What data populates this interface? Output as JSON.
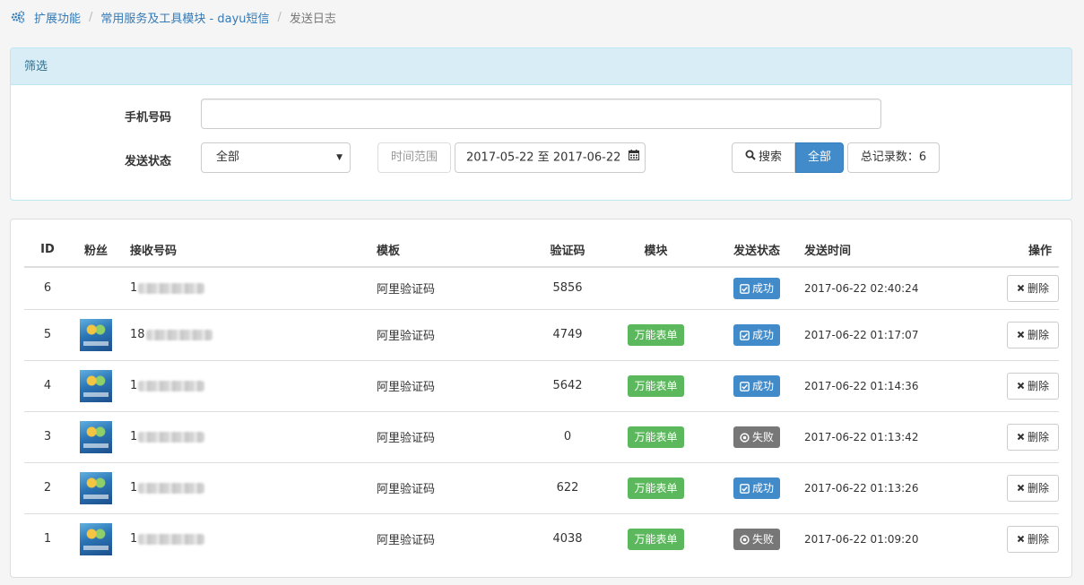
{
  "breadcrumb": {
    "items": [
      "扩展功能",
      "常用服务及工具模块 - dayu短信"
    ],
    "current": "发送日志",
    "separator": "/"
  },
  "filter": {
    "title": "筛选",
    "phone_label": "手机号码",
    "phone_value": "",
    "status_label": "发送状态",
    "status_selected": "全部",
    "time_label": "时间范围",
    "date_range": "2017-05-22 至 2017-06-22",
    "search_label": "搜索",
    "all_label": "全部",
    "total_label": "总记录数：6"
  },
  "table": {
    "headers": {
      "id": "ID",
      "fan": "粉丝",
      "phone": "接收号码",
      "template": "模板",
      "code": "验证码",
      "module": "模块",
      "status": "发送状态",
      "time": "发送时间",
      "action": "操作"
    },
    "rows": [
      {
        "id": "6",
        "avatar": false,
        "phone_prefix": "1",
        "template": "阿里验证码",
        "code": "5856",
        "module": "",
        "status": "成功",
        "status_type": "success",
        "time": "2017-06-22 02:40:24",
        "action": "删除"
      },
      {
        "id": "5",
        "avatar": true,
        "phone_prefix": "18",
        "template": "阿里验证码",
        "code": "4749",
        "module": "万能表单",
        "status": "成功",
        "status_type": "success",
        "time": "2017-06-22 01:17:07",
        "action": "删除"
      },
      {
        "id": "4",
        "avatar": true,
        "phone_prefix": "1",
        "template": "阿里验证码",
        "code": "5642",
        "module": "万能表单",
        "status": "成功",
        "status_type": "success",
        "time": "2017-06-22 01:14:36",
        "action": "删除"
      },
      {
        "id": "3",
        "avatar": true,
        "phone_prefix": "1",
        "template": "阿里验证码",
        "code": "0",
        "module": "万能表单",
        "status": "失败",
        "status_type": "fail",
        "time": "2017-06-22 01:13:42",
        "action": "删除"
      },
      {
        "id": "2",
        "avatar": true,
        "phone_prefix": "1",
        "template": "阿里验证码",
        "code": "622",
        "module": "万能表单",
        "status": "成功",
        "status_type": "success",
        "time": "2017-06-22 01:13:26",
        "action": "删除"
      },
      {
        "id": "1",
        "avatar": true,
        "phone_prefix": "1",
        "template": "阿里验证码",
        "code": "4038",
        "module": "万能表单",
        "status": "失败",
        "status_type": "fail",
        "time": "2017-06-22 01:09:20",
        "action": "删除"
      }
    ]
  },
  "colors": {
    "link": "#337ab7",
    "primary": "#428bca",
    "success": "#5cb85c",
    "fail": "#777777",
    "panel_info_bg": "#d9edf7"
  },
  "icons": {
    "breadcrumb": "gears-icon",
    "search": "search-icon",
    "calendar": "calendar-icon",
    "success": "check-square-icon",
    "fail": "ban-circle-icon",
    "delete": "close-icon"
  }
}
